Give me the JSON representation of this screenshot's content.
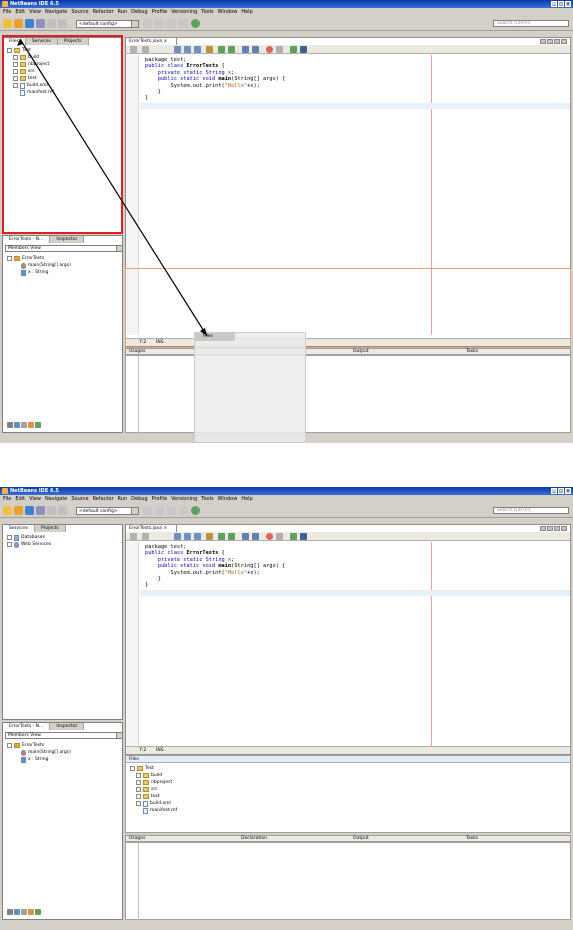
{
  "window": {
    "title": "NetBeans IDE 6.5"
  },
  "menu": [
    "File",
    "Edit",
    "View",
    "Navigate",
    "Source",
    "Refactor",
    "Run",
    "Debug",
    "Profile",
    "Versioning",
    "Tools",
    "Window",
    "Help"
  ],
  "toolbar": {
    "config_combo": "<default config>",
    "search_placeholder": "Search (Ctrl+I)"
  },
  "shotA": {
    "left_tabs": [
      "Files",
      "Services",
      "Projects"
    ],
    "tree": [
      "Test",
      "build",
      "nbproject",
      "src",
      "test",
      "build.xml",
      "manifest.mf"
    ],
    "editor_tab": "ErrorTests.java",
    "status_pos": "7:2",
    "status_mode": "INS",
    "navigator_tabs": [
      "ErrorTests - N...",
      "Inspector"
    ],
    "navigator_view": "Members View",
    "nav_tree": [
      "ErrorTests",
      "main(String[] args)",
      "x : String"
    ],
    "drag_label": "Files",
    "bottom_headers": [
      "Usages",
      "Output",
      "Tasks"
    ]
  },
  "shotB": {
    "left_tabs": [
      "Services",
      "Projects"
    ],
    "tree": [
      "Databases",
      "Web Services"
    ],
    "editor_tab": "ErrorTests.java",
    "status_pos": "7:2",
    "status_mode": "INS",
    "navigator_tabs": [
      "ErrorTests - N...",
      "Inspector"
    ],
    "navigator_view": "Members View",
    "nav_tree": [
      "ErrorTests",
      "main(String[] args)",
      "x : String"
    ],
    "files_header": "Files",
    "files_tree": [
      "Test",
      "build",
      "nbproject",
      "src",
      "test",
      "build.xml",
      "manifest.mf"
    ],
    "bottom_headers": [
      "Usages",
      "Declaration",
      "Output",
      "Tasks"
    ]
  },
  "code": {
    "l1": "package test;",
    "l2a": "public class ",
    "l2b": "ErrorTests",
    "l3a": "    private static String ",
    "l3b": "x",
    "l4a": "    public static void ",
    "l4b": "main",
    "l4c": "(String[] args) {",
    "l5a": "        System.out.print(",
    "l5b": "\"Hello\"",
    "l5c": "+x);",
    "l6": "    }",
    "l7": "}"
  },
  "colors": {
    "highlight_red": "#e02020",
    "highlight_orange": "#f0a070",
    "arrow": "#000000"
  }
}
